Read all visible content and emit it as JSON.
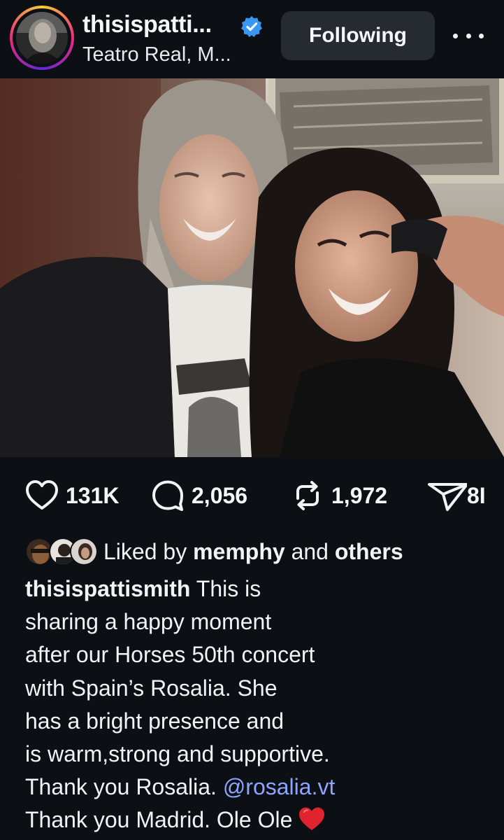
{
  "header": {
    "username": "thisispatti...",
    "location": "Teatro Real, M...",
    "follow_label": "Following",
    "verified": true
  },
  "actions": {
    "likes": "131K",
    "comments": "2,056",
    "reposts": "1,972",
    "shares": "8I"
  },
  "likes": {
    "prefix": "Liked by",
    "user": "memphy",
    "conjunction": "and",
    "others": "others"
  },
  "caption": {
    "author": "thisispattismith",
    "line1": "This is",
    "line2": "sharing a happy moment",
    "line3": "after our Horses 50th concert",
    "line4": "with Spain’s Rosalia. She",
    "line5": "has a bright presence and",
    "line6": "is warm,strong and supportive.",
    "line7": "Thank you Rosalia.",
    "mention": "@rosalia.vt",
    "line8": "Thank you Madrid. Ole Ole"
  },
  "colors": {
    "background": "#0c0f14",
    "button": "#262a31",
    "mention": "#8fa4ff",
    "verified": "#3897f0",
    "heart": "#e0242f"
  },
  "icons": {
    "verified": "verified-badge-icon",
    "more": "more-options-icon",
    "like": "heart-icon",
    "comment": "comment-bubble-icon",
    "repost": "repost-icon",
    "share": "send-icon",
    "emoji": "red-heart-icon"
  }
}
